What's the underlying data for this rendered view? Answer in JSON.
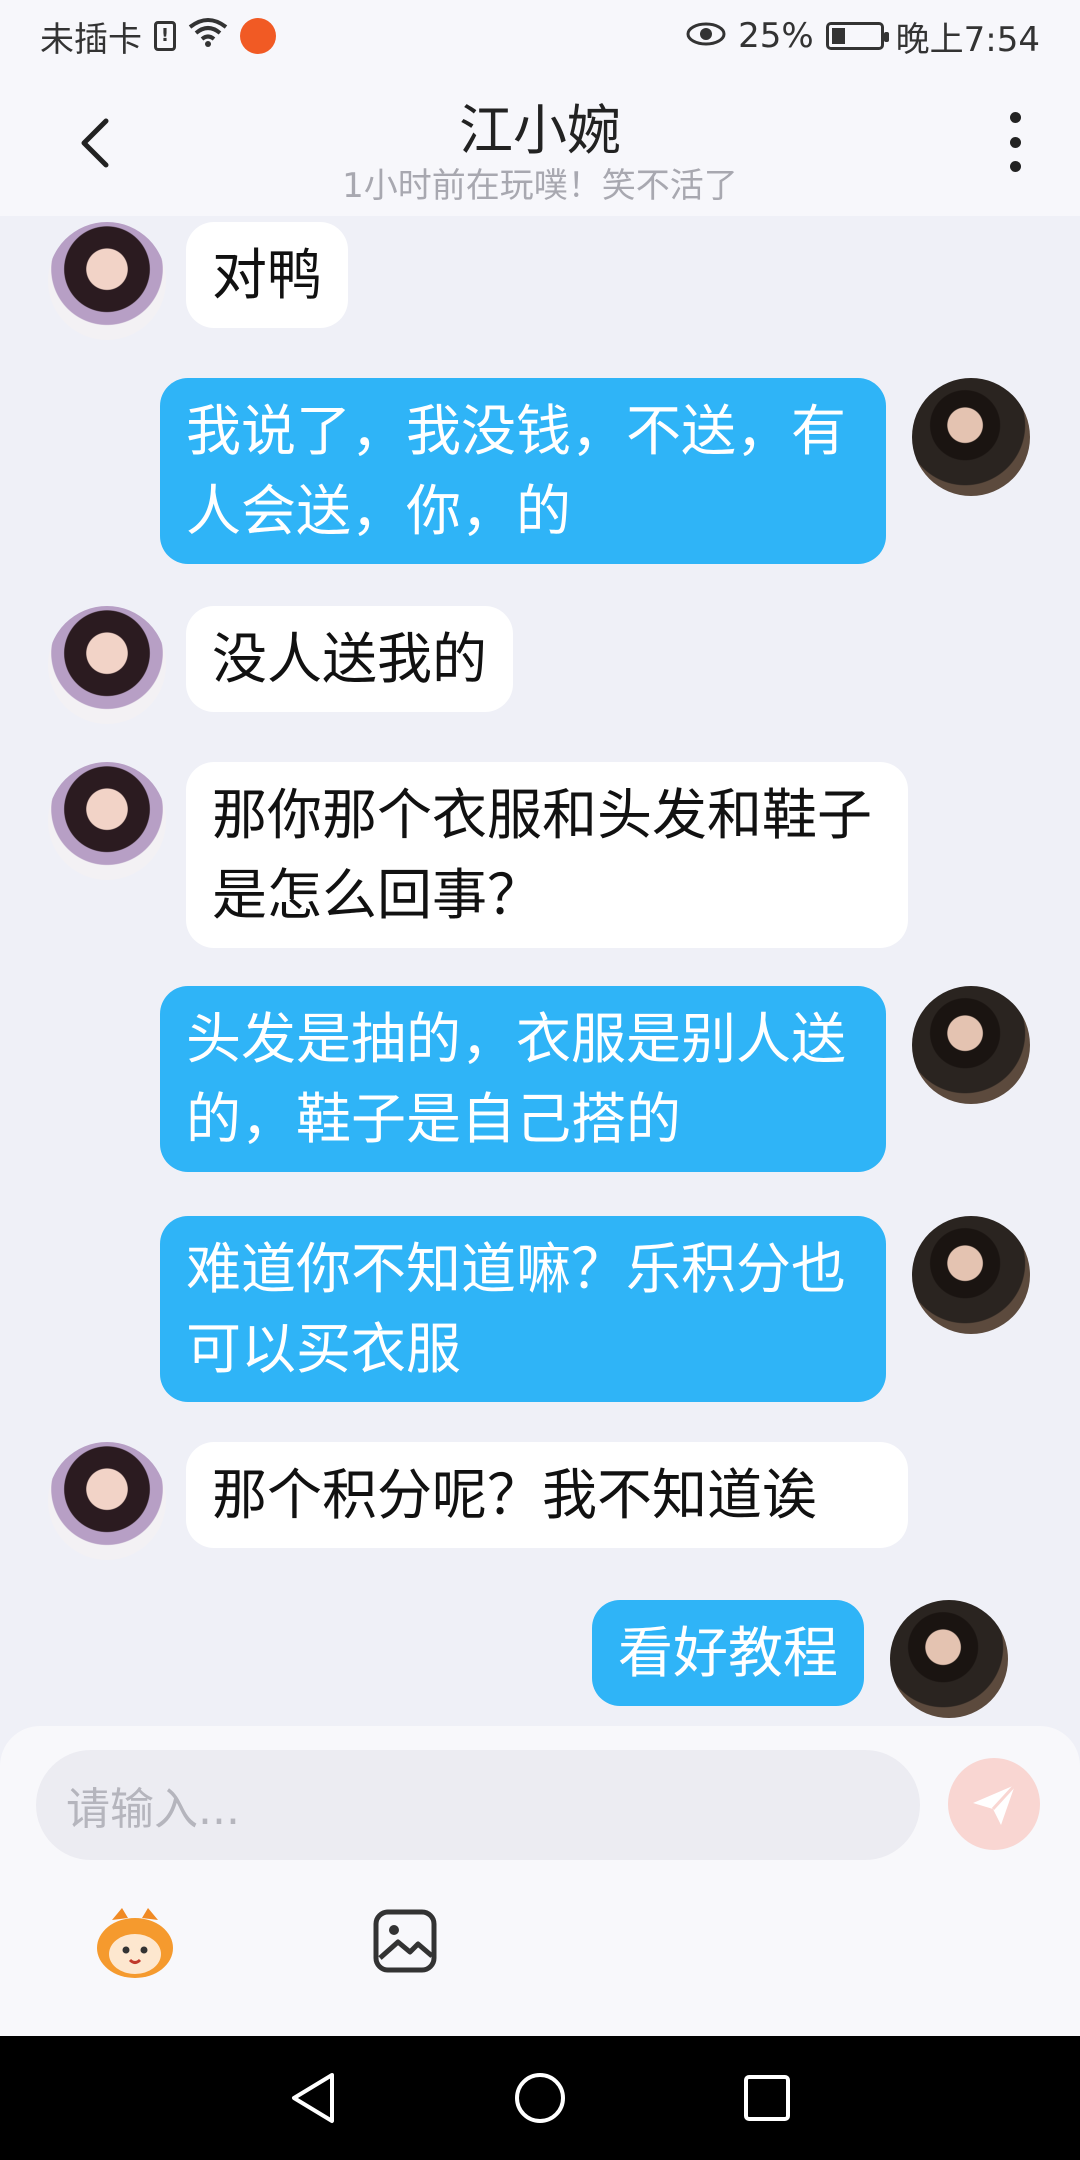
{
  "status_bar": {
    "carrier": "未插卡",
    "sim_badge": "!",
    "battery_percent": "25%",
    "time": "晚上7:54"
  },
  "header": {
    "title": "江小婉",
    "subtitle": "1小时前在玩噗！笑不活了"
  },
  "messages": [
    {
      "side": "incoming",
      "text": "对鸭"
    },
    {
      "side": "outgoing",
      "text": "我说了，我没钱，不送，有人会送，你，的"
    },
    {
      "side": "incoming",
      "text": "没人送我的"
    },
    {
      "side": "incoming",
      "text": "那你那个衣服和头发和鞋子是怎么回事？"
    },
    {
      "side": "outgoing",
      "text": "头发是抽的，衣服是别人送的，鞋子是自己搭的"
    },
    {
      "side": "outgoing",
      "text": "难道你不知道嘛？乐积分也可以买衣服"
    },
    {
      "side": "incoming",
      "text": "那个积分呢？我不知道诶"
    },
    {
      "side": "outgoing",
      "text": "看好教程"
    }
  ],
  "input": {
    "placeholder": "请输入..."
  },
  "colors": {
    "background": "#eff0f7",
    "outgoing_bubble": "#2fb4f7",
    "incoming_bubble": "#ffffff",
    "send_button": "#f9d6d2"
  },
  "icons": {
    "back": "back-arrow-icon",
    "more": "more-vertical-icon",
    "send": "send-plane-icon",
    "emoji": "emoji-mascot-icon",
    "image": "image-icon"
  }
}
